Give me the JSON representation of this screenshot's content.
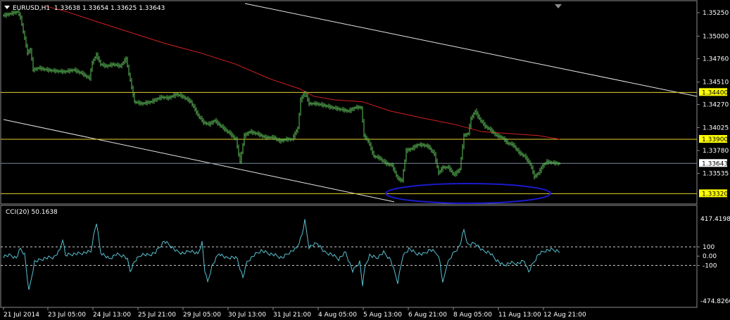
{
  "header": {
    "symbol": "EURUSD,H1",
    "ohlc": "1.33638 1.33654 1.33625 1.33643"
  },
  "indicator": {
    "label": "CCI(20) 50.1638",
    "scale_max_label": "417.4198",
    "scale_min_label": "-474.8266",
    "levels": [
      "100",
      "0.00",
      "-100"
    ]
  },
  "colors": {
    "price": "#5fc35a",
    "ma": "#d42020",
    "cci": "#58bfd0",
    "hline": "#e8d02e",
    "trendline": "#e6e6e6",
    "ellipse": "#1a1acc",
    "highlight_box": "#ffff00",
    "current_box": "#ffffff"
  },
  "chart_data": {
    "type": "line",
    "ylim": [
      1.3327,
      1.3531
    ],
    "price_ticks": [
      "1.35250",
      "1.35000",
      "1.34760",
      "1.34510",
      "1.34270",
      "1.34025",
      "1.33780",
      "1.33535"
    ],
    "price_tick_values": [
      1.3525,
      1.35,
      1.3476,
      1.3451,
      1.3427,
      1.34025,
      1.3378,
      1.33535
    ],
    "highlighted_levels": [
      {
        "label": "1.34400",
        "value": 1.344,
        "kind": "hline"
      },
      {
        "label": "1.33900",
        "value": 1.339,
        "kind": "hline"
      },
      {
        "label": "1.33643",
        "value": 1.33643,
        "kind": "current"
      },
      {
        "label": "1.33320",
        "value": 1.3332,
        "kind": "hline"
      }
    ],
    "x_labels": [
      "21 Jul 2014",
      "23 Jul 05:00",
      "24 Jul 13:00",
      "25 Jul 21:00",
      "29 Jul 05:00",
      "30 Jul 13:00",
      "31 Jul 21:00",
      "4 Aug 05:00",
      "5 Aug 13:00",
      "6 Aug 21:00",
      "8 Aug 05:00",
      "11 Aug 13:00",
      "12 Aug 21:00"
    ],
    "series": [
      {
        "x": [
          0,
          20,
          24,
          34,
          38,
          42,
          50,
          62,
          72,
          86,
          100,
          112,
          122,
          126,
          132,
          138,
          146,
          156,
          166,
          174,
          178,
          186,
          196,
          210,
          224,
          234,
          246,
          256,
          266,
          276,
          284,
          292,
          300,
          312,
          322,
          330,
          336,
          342,
          350,
          360,
          372,
          384,
          392,
          402,
          410,
          418,
          422,
          428,
          434,
          444,
          456,
          466,
          478,
          490,
          500,
          508,
          512,
          518,
          526,
          534,
          544,
          552,
          560,
          566,
          572,
          580,
          588,
          596,
          604,
          612,
          618,
          624,
          632,
          640,
          648,
          654,
          660,
          664,
          670,
          676,
          684,
          692,
          700,
          708,
          716,
          724,
          732,
          740,
          748,
          754,
          760,
          766,
          772,
          780,
          790
        ],
        "values": [
          1.3522,
          1.3526,
          1.352,
          1.3482,
          1.3486,
          1.3464,
          1.3466,
          1.3464,
          1.3463,
          1.3462,
          1.3464,
          1.346,
          1.3455,
          1.3472,
          1.348,
          1.347,
          1.3468,
          1.347,
          1.3468,
          1.3476,
          1.346,
          1.343,
          1.3428,
          1.343,
          1.3435,
          1.3434,
          1.3438,
          1.3435,
          1.343,
          1.3416,
          1.3408,
          1.3406,
          1.341,
          1.3402,
          1.3396,
          1.339,
          1.3366,
          1.3394,
          1.3398,
          1.3396,
          1.3392,
          1.3392,
          1.3388,
          1.339,
          1.339,
          1.3402,
          1.3432,
          1.344,
          1.3428,
          1.3428,
          1.3426,
          1.3424,
          1.3422,
          1.342,
          1.3424,
          1.3424,
          1.3394,
          1.3388,
          1.3372,
          1.337,
          1.3364,
          1.3362,
          1.3348,
          1.3346,
          1.3378,
          1.338,
          1.3384,
          1.3384,
          1.3382,
          1.3374,
          1.3354,
          1.336,
          1.336,
          1.3352,
          1.3358,
          1.3394,
          1.3396,
          1.3412,
          1.342,
          1.3412,
          1.3404,
          1.34,
          1.3394,
          1.3392,
          1.3386,
          1.3384,
          1.3376,
          1.3372,
          1.3364,
          1.335,
          1.3354,
          1.3362,
          1.3366,
          1.3365,
          1.3364
        ]
      },
      {
        "x": [
          60,
          90,
          130,
          180,
          230,
          280,
          330,
          380,
          420,
          440,
          470,
          510,
          550,
          600,
          640,
          680,
          720,
          760,
          790
        ],
        "values": [
          1.3532,
          1.3526,
          1.3516,
          1.3504,
          1.3492,
          1.3482,
          1.347,
          1.3454,
          1.3444,
          1.3436,
          1.3432,
          1.343,
          1.342,
          1.3412,
          1.3406,
          1.3398,
          1.3396,
          1.3394,
          1.339
        ]
      },
      {
        "x": [
          0,
          10,
          18,
          24,
          30,
          36,
          44,
          60,
          72,
          80,
          84,
          88,
          96,
          110,
          124,
          128,
          132,
          138,
          150,
          160,
          172,
          176,
          180,
          186,
          196,
          206,
          216,
          222,
          228,
          236,
          246,
          256,
          266,
          276,
          282,
          286,
          290,
          296,
          306,
          316,
          326,
          332,
          336,
          340,
          346,
          356,
          366,
          376,
          386,
          396,
          406,
          416,
          424,
          428,
          434,
          446,
          456,
          466,
          476,
          486,
          496,
          506,
          510,
          514,
          520,
          530,
          540,
          550,
          560,
          566,
          570,
          576,
          586,
          596,
          606,
          616,
          620,
          624,
          630,
          640,
          648,
          654,
          660,
          670,
          680,
          690,
          700,
          710,
          720,
          730,
          740,
          746,
          752,
          760,
          770,
          780,
          790
        ],
        "values": [
          0,
          10,
          -20,
          80,
          20,
          -380,
          -60,
          -20,
          -10,
          60,
          190,
          10,
          20,
          30,
          50,
          220,
          360,
          40,
          -30,
          20,
          0,
          -40,
          -160,
          -60,
          20,
          10,
          40,
          100,
          160,
          120,
          50,
          30,
          60,
          20,
          150,
          -160,
          -280,
          -110,
          30,
          -20,
          -10,
          -30,
          -130,
          -230,
          -60,
          10,
          60,
          30,
          10,
          -20,
          40,
          80,
          230,
          380,
          100,
          140,
          40,
          20,
          -30,
          40,
          -160,
          -60,
          -310,
          -100,
          10,
          -20,
          40,
          -40,
          -280,
          -40,
          30,
          80,
          30,
          20,
          70,
          30,
          -60,
          -300,
          -80,
          40,
          110,
          280,
          120,
          140,
          60,
          40,
          -40,
          -100,
          -70,
          -80,
          -50,
          -170,
          -80,
          20,
          60,
          70,
          50
        ]
      }
    ]
  }
}
